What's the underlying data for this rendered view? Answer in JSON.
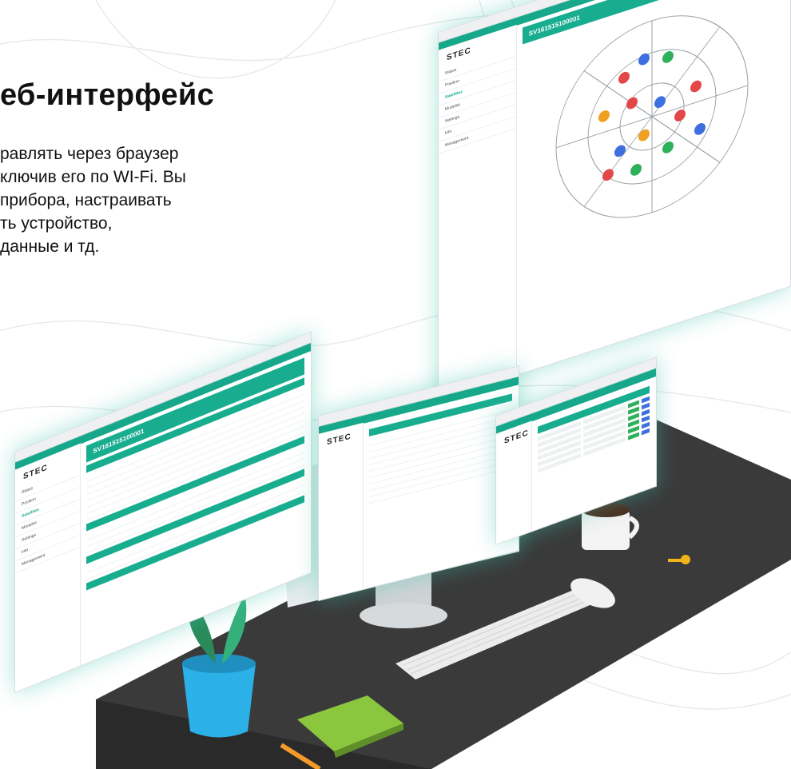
{
  "hero": {
    "title": "еб-интерфейс",
    "lines": [
      "равлять через браузер",
      "ключив его по WI-Fi. Вы",
      "прибора, настраивать",
      "ть устройство,",
      "данные и тд."
    ]
  },
  "windows": {
    "right": {
      "logo": "STEC",
      "device_id": "SV161515100001",
      "nav": [
        "Status",
        "Position",
        "Satellites",
        "Modules",
        "Settings",
        "Info",
        "Management"
      ],
      "active_nav": "Satellites"
    },
    "left": {
      "logo": "STEC",
      "device_id": "SV161515100001",
      "nav": [
        "Status",
        "Position",
        "Satellites",
        "Modules",
        "Settings",
        "Info",
        "Management"
      ],
      "active_nav": "Satellites"
    },
    "center": {
      "logo": "STEC"
    },
    "table": {
      "logo": "STEC"
    }
  },
  "colors": {
    "accent": "#19ad90",
    "glow": "#40c4aa",
    "desk": "#3a3a3a",
    "button_green": "#2fb05a",
    "button_blue": "#3d6fe0"
  }
}
